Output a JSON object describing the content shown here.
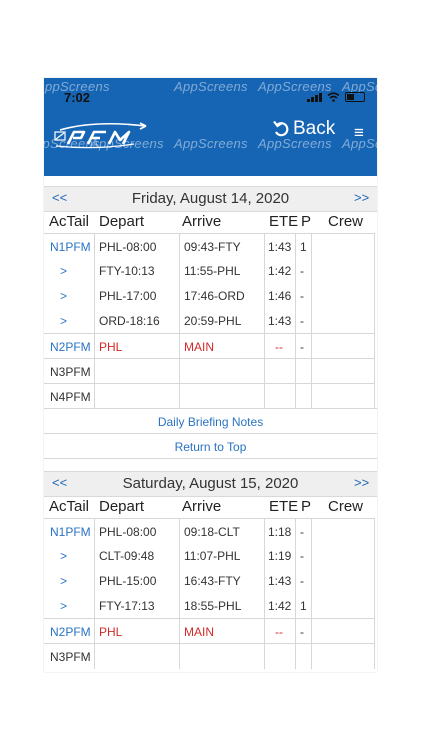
{
  "status": {
    "time": "7:02"
  },
  "header": {
    "watermark": "AppScreens",
    "back_label": "Back",
    "menu_glyph": "≡",
    "brand_color": "#1665b4"
  },
  "columns": [
    "AcTail",
    "Depart",
    "Arrive",
    "ETE",
    "P",
    "Crew"
  ],
  "days": [
    {
      "prev": "<<",
      "next": ">>",
      "title": "Friday, August 14, 2020",
      "rows": [
        {
          "tail": "N1PFM",
          "depart": "PHL-08:00",
          "arrive": "09:43-FTY",
          "ete": "1:43",
          "p": "1"
        },
        {
          "tail": ">",
          "depart": "FTY-10:13",
          "arrive": "11:55-PHL",
          "ete": "1:42",
          "p": "-"
        },
        {
          "tail": ">",
          "depart": "PHL-17:00",
          "arrive": "17:46-ORD",
          "ete": "1:46",
          "p": "-"
        },
        {
          "tail": ">",
          "depart": "ORD-18:16",
          "arrive": "20:59-PHL",
          "ete": "1:43",
          "p": "-"
        },
        {
          "tail": "N2PFM",
          "depart": "PHL",
          "arrive": "MAIN",
          "ete": "--",
          "p": "-"
        },
        {
          "tail": "N3PFM",
          "depart": "",
          "arrive": "",
          "ete": "",
          "p": ""
        },
        {
          "tail": "N4PFM",
          "depart": "",
          "arrive": "",
          "ete": "",
          "p": ""
        }
      ],
      "links": [
        "Daily Briefing Notes",
        "Return to Top"
      ]
    },
    {
      "prev": "<<",
      "next": ">>",
      "title": "Saturday, August 15, 2020",
      "rows": [
        {
          "tail": "N1PFM",
          "depart": "PHL-08:00",
          "arrive": "09:18-CLT",
          "ete": "1:18",
          "p": "-"
        },
        {
          "tail": ">",
          "depart": "CLT-09:48",
          "arrive": "11:07-PHL",
          "ete": "1:19",
          "p": "-"
        },
        {
          "tail": ">",
          "depart": "PHL-15:00",
          "arrive": "16:43-FTY",
          "ete": "1:43",
          "p": "-"
        },
        {
          "tail": ">",
          "depart": "FTY-17:13",
          "arrive": "18:55-PHL",
          "ete": "1:42",
          "p": "1"
        },
        {
          "tail": "N2PFM",
          "depart": "PHL",
          "arrive": "MAIN",
          "ete": "--",
          "p": "-"
        },
        {
          "tail": "N3PFM",
          "depart": "",
          "arrive": "",
          "ete": "",
          "p": ""
        }
      ]
    }
  ]
}
